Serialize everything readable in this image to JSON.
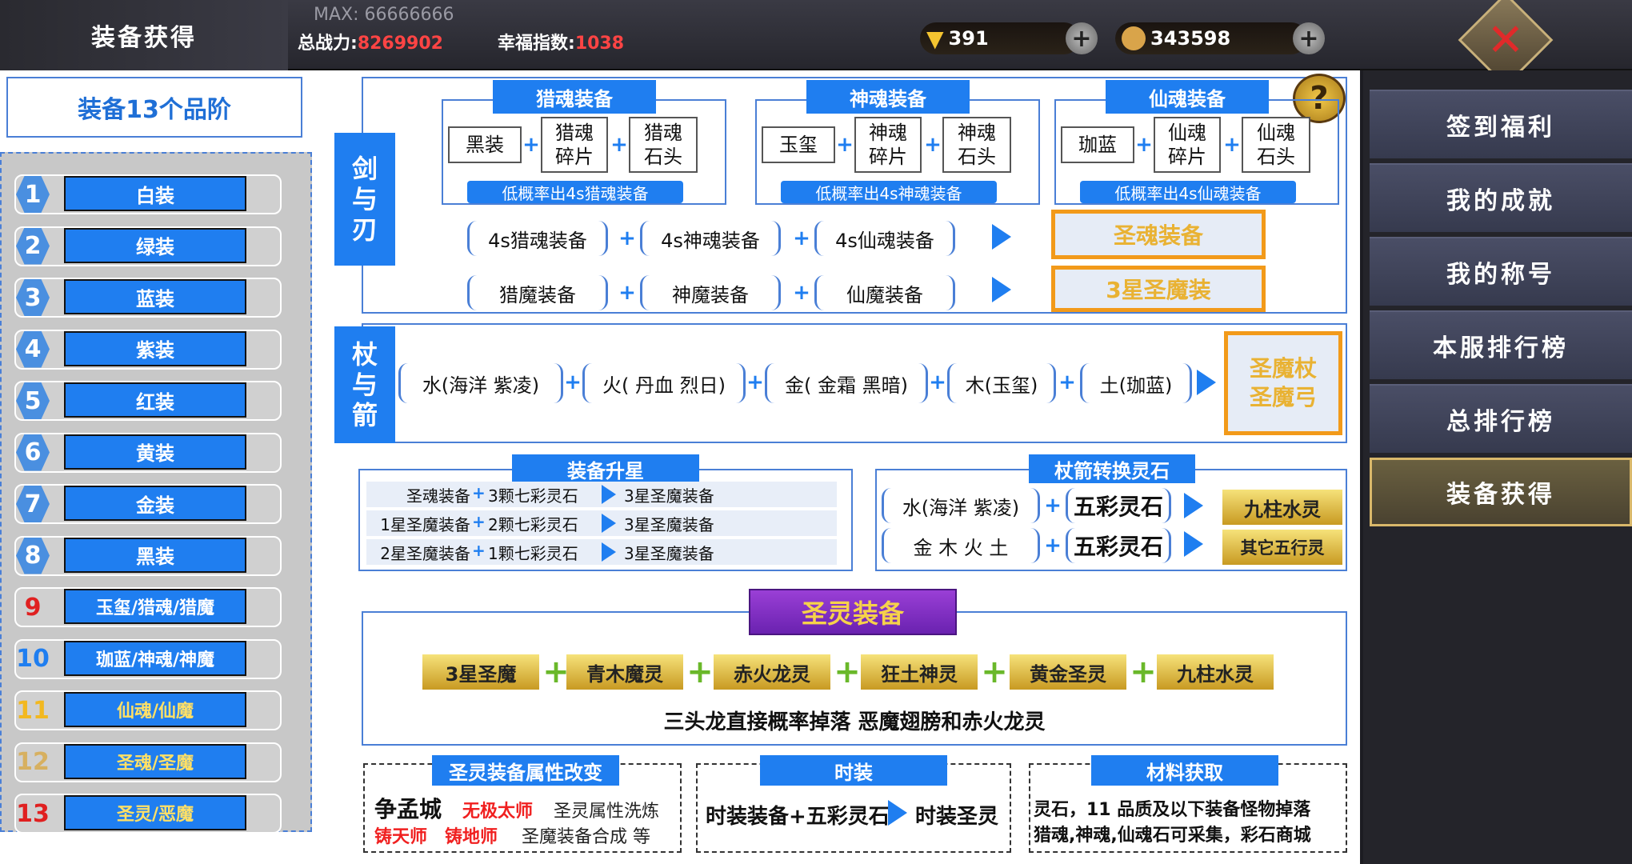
{
  "header": {
    "title": "装备获得",
    "max_label": "MAX: 66666666",
    "power_label": "总战力:",
    "power_value": "8269902",
    "happiness_label": "幸福指数:",
    "happiness_value": "1038",
    "gold": "391",
    "coins": "343598"
  },
  "grades": {
    "title": "装备13个品阶",
    "items": [
      {
        "num": "1",
        "label": "白装"
      },
      {
        "num": "2",
        "label": "绿装"
      },
      {
        "num": "3",
        "label": "蓝装"
      },
      {
        "num": "4",
        "label": "紫装"
      },
      {
        "num": "5",
        "label": "红装"
      },
      {
        "num": "6",
        "label": "黄装"
      },
      {
        "num": "7",
        "label": "金装"
      },
      {
        "num": "8",
        "label": "黑装"
      },
      {
        "num": "9",
        "label": "玉玺/猎魂/猎魔"
      },
      {
        "num": "10",
        "label": "珈蓝/神魂/神魔"
      },
      {
        "num": "11",
        "label": "仙魂/仙魔"
      },
      {
        "num": "12",
        "label": "圣魂/圣魔"
      },
      {
        "num": "13",
        "label": "圣灵/恶魔"
      }
    ]
  },
  "sword": {
    "tab": [
      "剑",
      "与",
      "刃"
    ],
    "groups": [
      {
        "title": "猎魂装备",
        "a": "黑装",
        "b": "猎魂\n碎片",
        "c": "猎魂\n石头",
        "note": "低概率出4s猎魂装备"
      },
      {
        "title": "神魂装备",
        "a": "玉玺",
        "b": "神魂\n碎片",
        "c": "神魂\n石头",
        "note": "低概率出4s神魂装备"
      },
      {
        "title": "仙魂装备",
        "a": "珈蓝",
        "b": "仙魂\n碎片",
        "c": "仙魂\n石头",
        "note": "低概率出4s仙魂装备"
      }
    ],
    "row1": [
      "4s猎魂装备",
      "4s神魂装备",
      "4s仙魂装备"
    ],
    "row1_result": "圣魂装备",
    "row2": [
      "猎魔装备",
      "神魔装备",
      "仙魔装备"
    ],
    "row2_result": "3星圣魔装"
  },
  "staff": {
    "tab": [
      "杖",
      "与",
      "箭"
    ],
    "items": [
      "水(海洋 紫凌)",
      "火( 丹血 烈日)",
      "金( 金霜 黑暗)",
      "木(玉玺)",
      "土(珈蓝)"
    ],
    "result": "圣魔杖\n圣魔弓"
  },
  "upgrade": {
    "title": "装备升星",
    "rows": [
      [
        "圣魂装备",
        "3颗七彩灵石",
        "3星圣魔装备"
      ],
      [
        "1星圣魔装备",
        "2颗七彩灵石",
        "3星圣魔装备"
      ],
      [
        "2星圣魔装备",
        "1颗七彩灵石",
        "3星圣魔装备"
      ]
    ]
  },
  "convert": {
    "title": "杖箭转换灵石",
    "rows": [
      {
        "src": "水(海洋 紫凌)",
        "stone": "五彩灵石",
        "result": "九柱水灵"
      },
      {
        "src": "金 木 火 土",
        "stone": "五彩灵石",
        "result": "其它五行灵"
      }
    ]
  },
  "holy": {
    "title": "圣灵装备",
    "items": [
      "3星圣魔",
      "青木魔灵",
      "赤火龙灵",
      "狂土神灵",
      "黄金圣灵",
      "九柱水灵"
    ],
    "note": "三头龙直接概率掉落  恶魔翅膀和赤火龙灵"
  },
  "bottom": {
    "attr_title": "圣灵装备属性改变",
    "attr_city": "争孟城",
    "attr_master1": "无极太师",
    "attr_text1": "圣灵属性洗炼",
    "attr_master2": "铸天师",
    "attr_master3": "铸地师",
    "attr_text2": "圣魔装备合成 等",
    "fashion_title": "时装",
    "fashion_left": "时装装备+五彩灵石",
    "fashion_right": "时装圣灵",
    "material_title": "材料获取",
    "material_line1": "灵石，11 品质及以下装备怪物掉落",
    "material_line2": "猎魂,神魂,仙魂石可采集，彩石商城"
  },
  "menu": {
    "items": [
      "签到福利",
      "我的成就",
      "我的称号",
      "本服排行榜",
      "总排行榜",
      "装备获得"
    ]
  },
  "colors": {
    "accent_blue": "#1f7ef0",
    "orange": "#f29a1a",
    "red": "#ff4444",
    "holy_purple": "#7a2fc0"
  }
}
